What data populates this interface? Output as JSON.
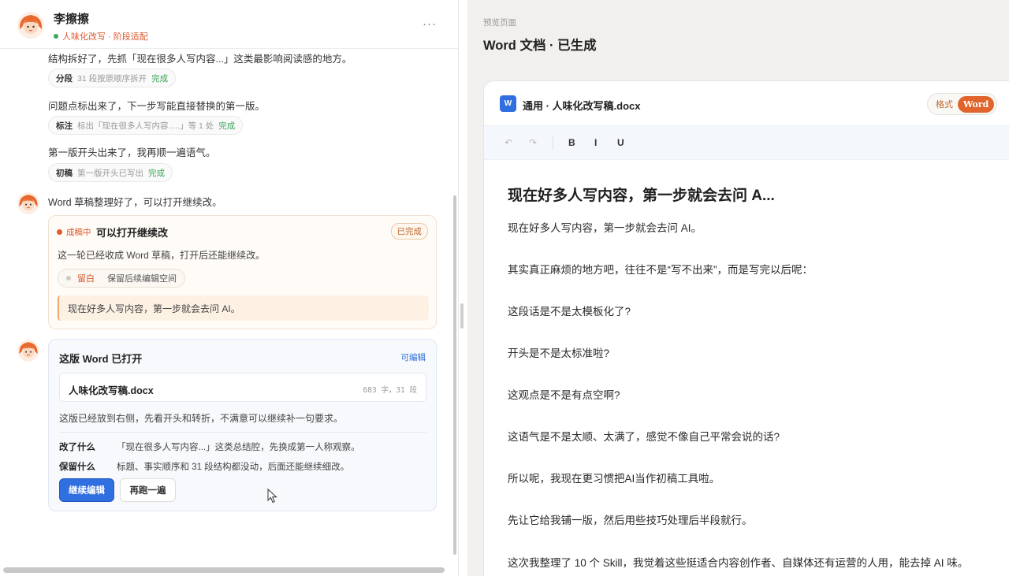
{
  "chat": {
    "contact_name": "李擦擦",
    "status": "人味化改写 · 阶段适配",
    "more_label": "···",
    "steps": [
      {
        "text": "结构拆好了，先抓「现在很多人写内容...」这类最影响阅读感的地方。",
        "tag": "分段",
        "desc": "31 段按原顺序拆开",
        "state": "完成"
      },
      {
        "text": "问题点标出来了，下一步写能直接替换的第一版。",
        "tag": "标注",
        "desc": "标出「现在很多人写内容.....」等 1 处",
        "state": "完成"
      },
      {
        "text": "第一版开头出来了，我再顺一遍语气。",
        "tag": "初稿",
        "desc": "第一版开头已写出",
        "state": "完成"
      }
    ],
    "draft_message": "Word 草稿整理好了，可以打开继续改。",
    "draft_card": {
      "stage": "成稿中",
      "title": "可以打开继续改",
      "badge": "已完成",
      "desc": "这一轮已经收成 Word 草稿，打开后还能继续改。",
      "keep_tag": "留白",
      "keep_desc": "保留后续编辑空间",
      "quote": "现在好多人写内容，第一步就会去问 AI。"
    },
    "open_card": {
      "title": "这版 Word 已打开",
      "editable": "可编辑",
      "file_name": "人味化改写稿.docx",
      "file_meta": "683 字，31 段",
      "desc": "这版已经放到右侧，先看开头和转折，不满意可以继续补一句要求。",
      "changed_key": "改了什么",
      "changed_val": "「现在很多人写内容...」这类总结腔，先换成第一人称观察。",
      "kept_key": "保留什么",
      "kept_val": "标题、事实顺序和 31 段结构都没动，后面还能继续细改。",
      "continue_label": "继续编辑",
      "rerun_label": "再跑一遍"
    }
  },
  "preview": {
    "label": "预览页面",
    "title": "Word 文档 · 已生成",
    "file_icon": "W",
    "file_name": "通用 · 人味化改写稿.docx",
    "format_label": "格式",
    "format_value": "Word",
    "toolbar": {
      "undo": "↶",
      "redo": "↷",
      "bold": "B",
      "italic": "I",
      "underline": "U"
    },
    "heading": "现在好多人写内容，第一步就会去问 A...",
    "paragraphs": [
      "现在好多人写内容，第一步就会去问 AI。",
      "其实真正麻烦的地方吧，往往不是“写不出来”，而是写完以后呢：",
      "这段话是不是太模板化了?",
      "开头是不是太标准啦?",
      "这观点是不是有点空啊?",
      "这语气是不是太顺、太满了，感觉不像自己平常会说的话?",
      "所以呢，我现在更习惯把AI当作初稿工具啦。",
      "先让它给我铺一版，然后用些技巧处理后半段就行。",
      "这次我整理了 10 个 Skill，我觉着这些挺适合内容创作者、自媒体还有运营的人用，能去掉 AI 味。"
    ]
  },
  "colors": {
    "accent": "#2f6fe0",
    "brand_orange": "#e0642b",
    "done_green": "#3aa757"
  }
}
